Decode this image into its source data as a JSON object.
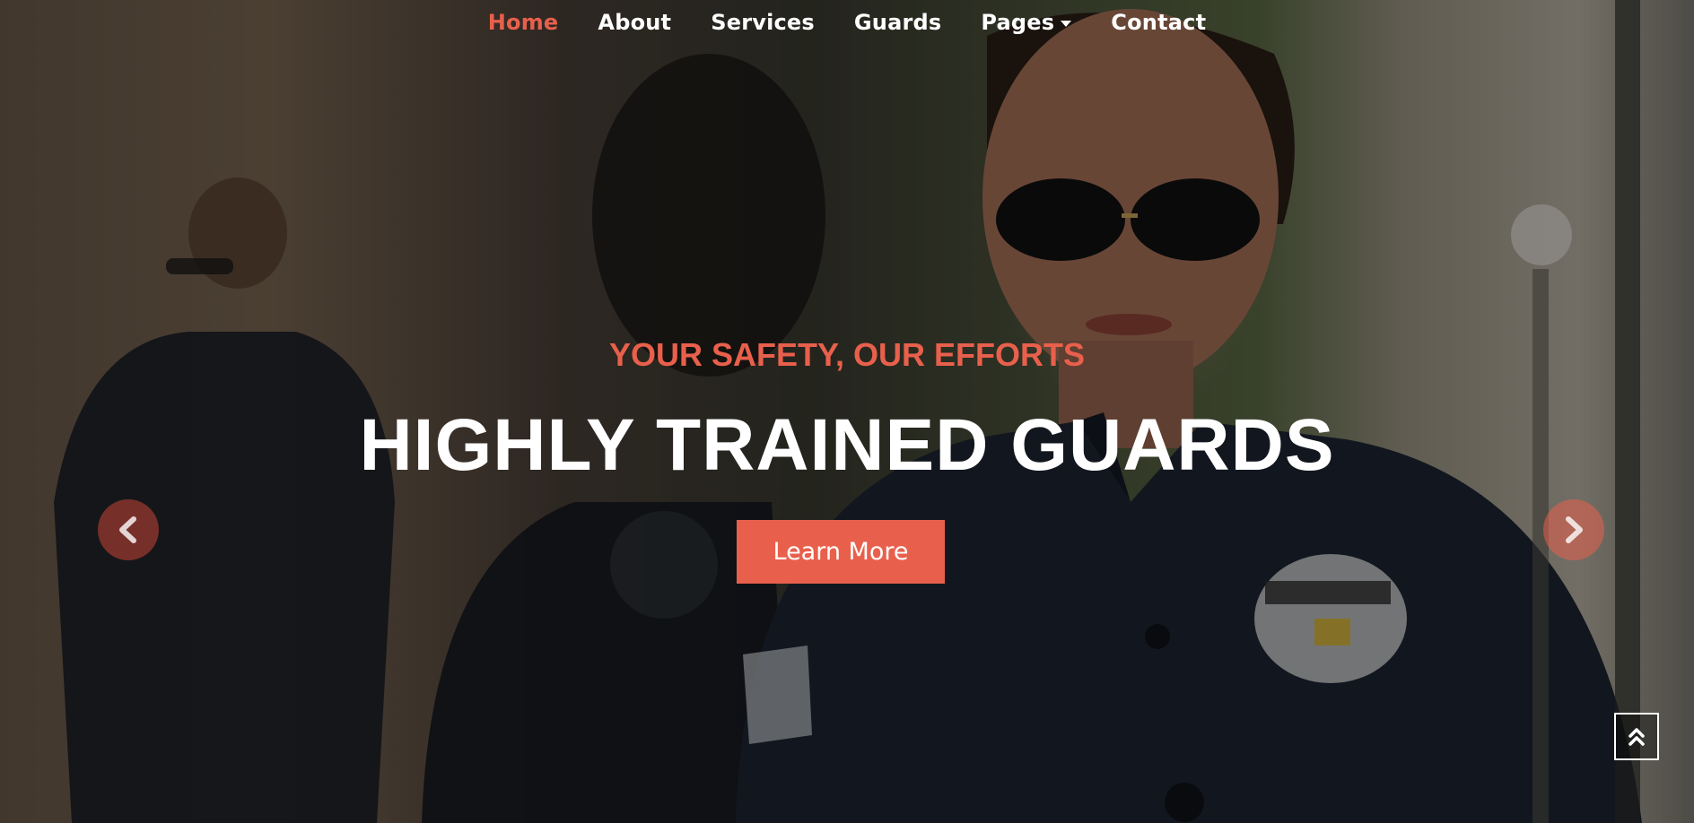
{
  "nav": {
    "items": [
      {
        "label": "Home",
        "active": true
      },
      {
        "label": "About"
      },
      {
        "label": "Services"
      },
      {
        "label": "Guards"
      },
      {
        "label": "Pages",
        "has_dropdown": true
      },
      {
        "label": "Contact"
      }
    ]
  },
  "hero": {
    "subtitle": "YOUR SAFETY, OUR EFFORTS",
    "title": "HIGHLY TRAINED GUARDS",
    "cta_label": "Learn More"
  },
  "controls": {
    "prev_icon": "chevron-left-icon",
    "next_icon": "chevron-right-icon",
    "back_to_top_icon": "double-chevron-up-icon"
  },
  "colors": {
    "accent": "#e8604c",
    "text": "#ffffff"
  }
}
